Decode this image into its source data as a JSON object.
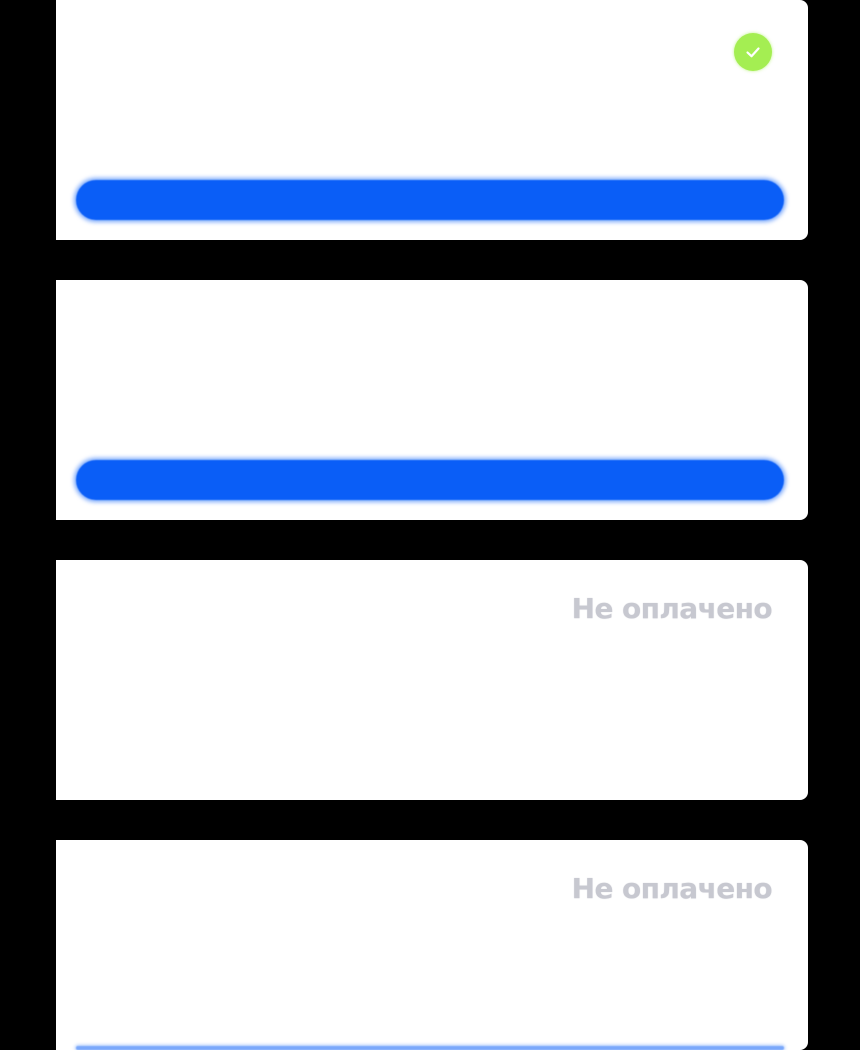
{
  "colors": {
    "background": "#000000",
    "card": "#ffffff",
    "primary_button": "#0a5ef7",
    "paid_indicator": "#a4ee52",
    "status_text": "#c7c8d0"
  },
  "cards": [
    {
      "status_icon": "check-icon",
      "has_button": true
    },
    {
      "has_button": true
    },
    {
      "status_text": "Не оплачено"
    },
    {
      "status_text": "Не оплачено"
    }
  ]
}
